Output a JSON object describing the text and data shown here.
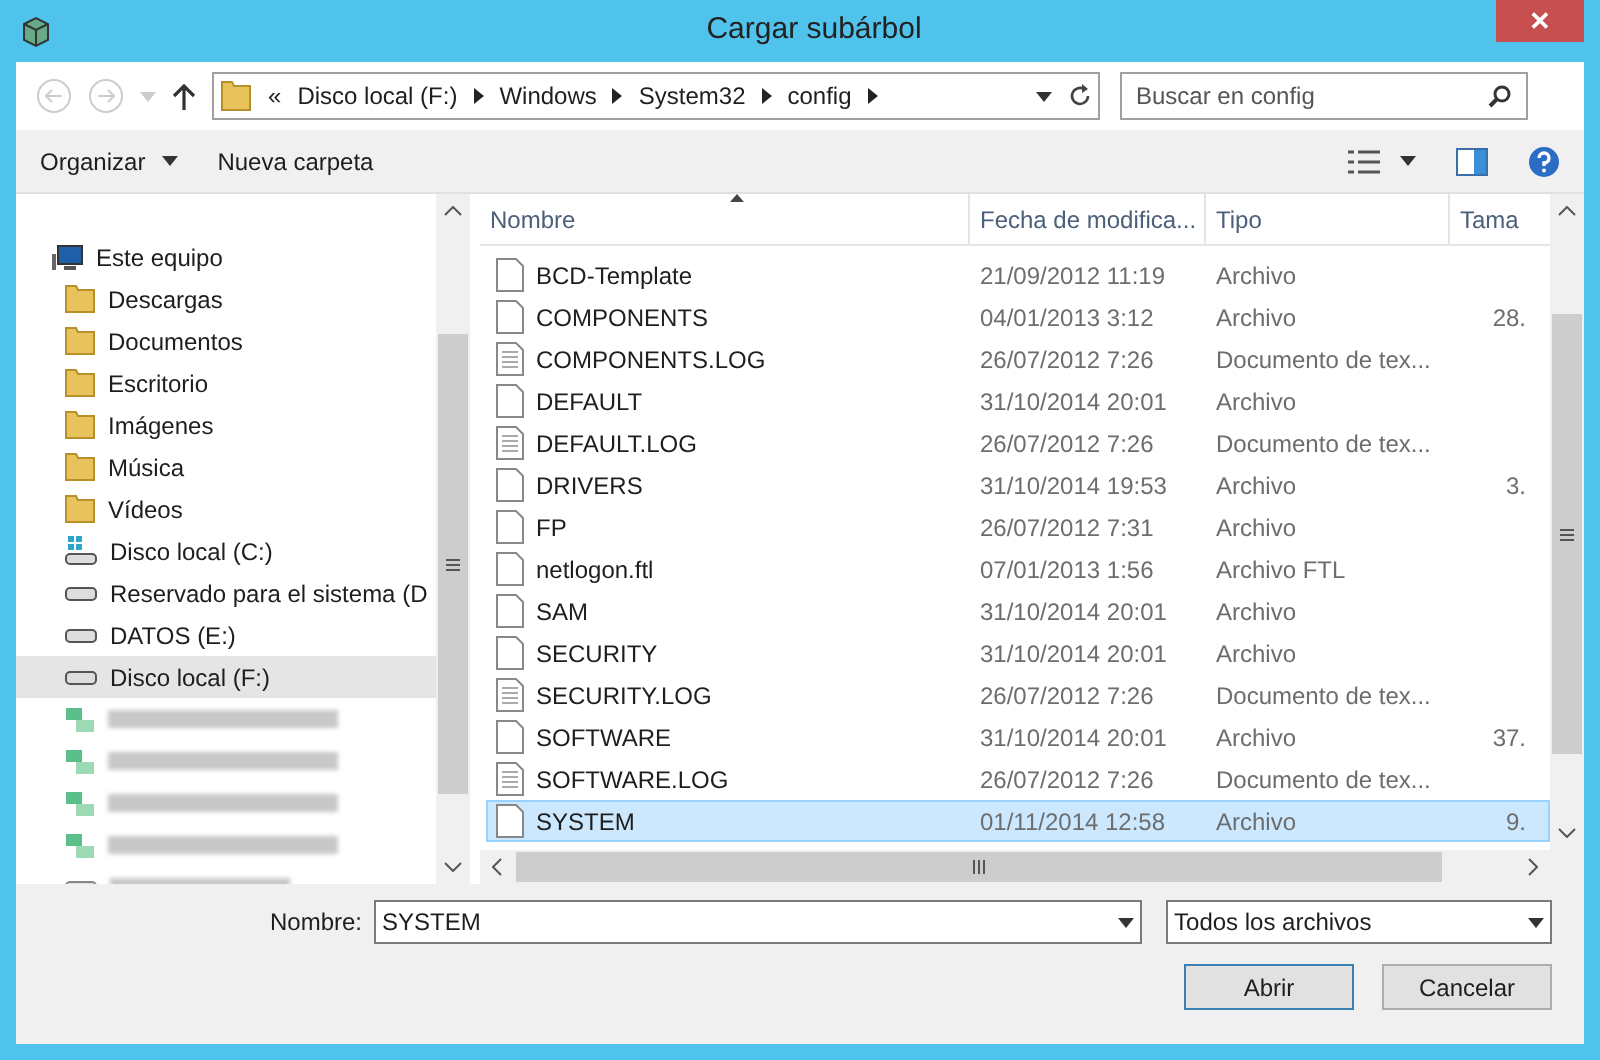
{
  "window": {
    "title": "Cargar subárbol",
    "close": "✕"
  },
  "address": {
    "overflow": "«",
    "crumbs": [
      "Disco local (F:)",
      "Windows",
      "System32",
      "config"
    ]
  },
  "search": {
    "placeholder": "Buscar en config"
  },
  "toolbar": {
    "organize": "Organizar",
    "new_folder": "Nueva carpeta"
  },
  "sidebar": {
    "items": [
      {
        "label": "Este equipo",
        "kind": "computer",
        "selected": false,
        "children": [
          {
            "label": "Descargas",
            "kind": "folder",
            "selected": false
          },
          {
            "label": "Documentos",
            "kind": "folder",
            "selected": false
          },
          {
            "label": "Escritorio",
            "kind": "folder",
            "selected": false
          },
          {
            "label": "Imágenes",
            "kind": "folder",
            "selected": false
          },
          {
            "label": "Música",
            "kind": "folder",
            "selected": false
          },
          {
            "label": "Vídeos",
            "kind": "folder",
            "selected": false
          },
          {
            "label": "Disco local (C:)",
            "kind": "system-drive",
            "selected": false
          },
          {
            "label": "Reservado para el sistema (D",
            "kind": "drive",
            "selected": false
          },
          {
            "label": "DATOS (E:)",
            "kind": "drive",
            "selected": false
          },
          {
            "label": "Disco local (F:)",
            "kind": "drive",
            "selected": true
          },
          {
            "kind": "blurred-network",
            "selected": false
          },
          {
            "kind": "blurred-network",
            "selected": false
          },
          {
            "kind": "blurred-network",
            "selected": false
          },
          {
            "kind": "blurred-network",
            "selected": false
          },
          {
            "kind": "blurred-drive",
            "selected": false
          }
        ]
      }
    ]
  },
  "table": {
    "columns": [
      "Nombre",
      "Fecha de modifica...",
      "Tipo",
      "Tama"
    ],
    "rows": [
      {
        "name": "BCD-Template",
        "date": "21/09/2012 11:19",
        "type": "Archivo",
        "kind": "file",
        "selected": false
      },
      {
        "name": "COMPONENTS",
        "date": "04/01/2013 3:12",
        "type": "Archivo",
        "size": "28.",
        "kind": "file",
        "selected": false
      },
      {
        "name": "COMPONENTS.LOG",
        "date": "26/07/2012 7:26",
        "type": "Documento de tex...",
        "kind": "text",
        "selected": false
      },
      {
        "name": "DEFAULT",
        "date": "31/10/2014 20:01",
        "type": "Archivo",
        "kind": "file",
        "selected": false
      },
      {
        "name": "DEFAULT.LOG",
        "date": "26/07/2012 7:26",
        "type": "Documento de tex...",
        "kind": "text",
        "selected": false
      },
      {
        "name": "DRIVERS",
        "date": "31/10/2014 19:53",
        "type": "Archivo",
        "size": "3.",
        "kind": "file",
        "selected": false
      },
      {
        "name": "FP",
        "date": "26/07/2012 7:31",
        "type": "Archivo",
        "kind": "file",
        "selected": false
      },
      {
        "name": "netlogon.ftl",
        "date": "07/01/2013 1:56",
        "type": "Archivo FTL",
        "kind": "file",
        "selected": false
      },
      {
        "name": "SAM",
        "date": "31/10/2014 20:01",
        "type": "Archivo",
        "kind": "file",
        "selected": false
      },
      {
        "name": "SECURITY",
        "date": "31/10/2014 20:01",
        "type": "Archivo",
        "kind": "file",
        "selected": false
      },
      {
        "name": "SECURITY.LOG",
        "date": "26/07/2012 7:26",
        "type": "Documento de tex...",
        "kind": "text",
        "selected": false
      },
      {
        "name": "SOFTWARE",
        "date": "31/10/2014 20:01",
        "type": "Archivo",
        "size": "37.",
        "kind": "file",
        "selected": false
      },
      {
        "name": "SOFTWARE.LOG",
        "date": "26/07/2012 7:26",
        "type": "Documento de tex...",
        "kind": "text",
        "selected": false
      },
      {
        "name": "SYSTEM",
        "date": "01/11/2014 12:58",
        "type": "Archivo",
        "size": "9.",
        "kind": "file",
        "selected": true
      }
    ]
  },
  "filename": {
    "label": "Nombre:",
    "value": "SYSTEM"
  },
  "filter": {
    "value": "Todos los archivos"
  },
  "buttons": [
    "Abrir",
    "Cancelar"
  ]
}
